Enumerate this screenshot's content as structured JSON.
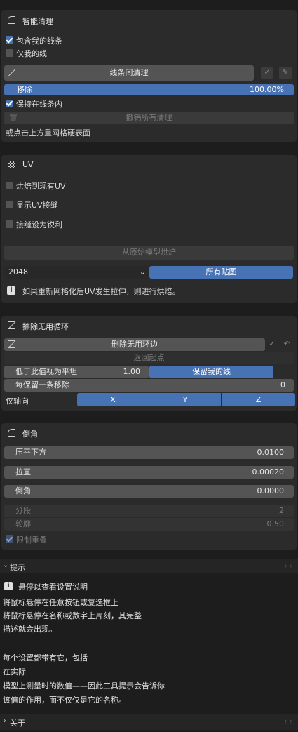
{
  "smart_cleanup": {
    "title": "智能清理",
    "include_my_lines": "包含我的线条",
    "only_my_lines": "仅我的线",
    "clean_between_lines": "线条间清理",
    "remove_label": "移除",
    "remove_value": "100.00%",
    "remove_fraction": 1.0,
    "keep_in_lines": "保持在线条内",
    "undo_all_cleanup": "撤销所有清理",
    "click_hint": "或点击上方重网格硬表面"
  },
  "uv": {
    "title": "UV",
    "bake_to_existing": "烘焙到现有UV",
    "show_uv_seams": "显示UV接缝",
    "seams_as_sharp": "接缝设为锐利",
    "bake_from_original": "从原始模型烘焙",
    "resolution": "2048",
    "all_textures": "所有贴图",
    "info": "如果重新网格化后UV发生拉伸，则进行烘焙。"
  },
  "erase_loops": {
    "title": "擦除无用循环",
    "delete_loops": "删除无用环边",
    "return_start": "返回起点",
    "flat_below_label": "低于此值视为平坦",
    "flat_below_value": "1.00",
    "keep_my_lines": "保留我的线",
    "remove_every_label": "每保留一条移除",
    "remove_every_value": "0",
    "axis_only_label": "仅轴向",
    "axis_x": "X",
    "axis_y": "Y",
    "axis_z": "Z"
  },
  "bevel": {
    "title": "倒角",
    "flatten_down_label": "压平下方",
    "flatten_down_value": "0.0100",
    "straighten_label": "拉直",
    "straighten_value": "0.00020",
    "bevel_label": "倒角",
    "bevel_value": "0.0000",
    "segments_label": "分段",
    "segments_value": "2",
    "profile_label": "轮廓",
    "profile_value": "0.50",
    "limit_overlap": "限制重叠"
  },
  "tips": {
    "title": "提示",
    "hover_header": "悬停以查看设置说明",
    "lines": [
      "将鼠标悬停在任意按钮或复选框上",
      "将鼠标悬停在名称或数字上片刻，其完整",
      "描述就会出现。",
      "",
      "每个设置都带有它，包括",
      "在实际",
      "模型上测量时的数值——因此工具提示会告诉你",
      "该值的作用，而不仅仅是它的名称。"
    ]
  },
  "about": {
    "title": "关于"
  }
}
